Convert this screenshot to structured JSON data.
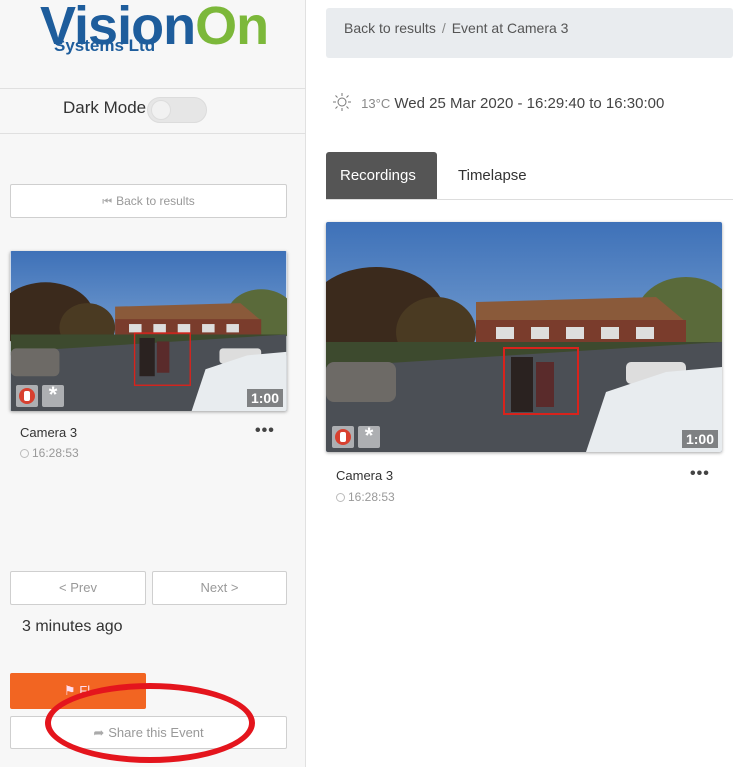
{
  "logo": {
    "main_a": "Vision",
    "main_b": "On",
    "sub": "Systems Ltd"
  },
  "sidebar": {
    "dark_mode_label": "Dark Mode",
    "dark_mode_on": false,
    "back_button": "Back to results",
    "card": {
      "camera": "Camera 3",
      "time": "16:28:53",
      "duration": "1:00",
      "more": "•••"
    },
    "prev_label": "< Prev",
    "next_label": "Next >",
    "time_ago": "3 minutes ago",
    "flag_label": "Fl",
    "share_label": "Share this Event"
  },
  "breadcrumb": {
    "back": "Back to results",
    "current": "Event at Camera 3"
  },
  "event": {
    "temperature": "13°C",
    "datetime": "Wed 25 Mar 2020 - 16:29:40 to 16:30:00"
  },
  "tabs": [
    {
      "label": "Recordings",
      "active": true
    },
    {
      "label": "Timelapse",
      "active": false
    }
  ],
  "main_card": {
    "camera": "Camera 3",
    "time": "16:28:53",
    "duration": "1:00",
    "more": "•••"
  },
  "colors": {
    "brand_blue": "#1e5d9c",
    "brand_green": "#7cb83a",
    "flag_orange": "#f26522",
    "highlight_red": "#e4151d"
  },
  "icons": [
    "backward-icon",
    "sun-icon",
    "clock-icon",
    "share-arrow-icon",
    "flag-icon",
    "person-alert-icon",
    "motion-star-icon"
  ]
}
